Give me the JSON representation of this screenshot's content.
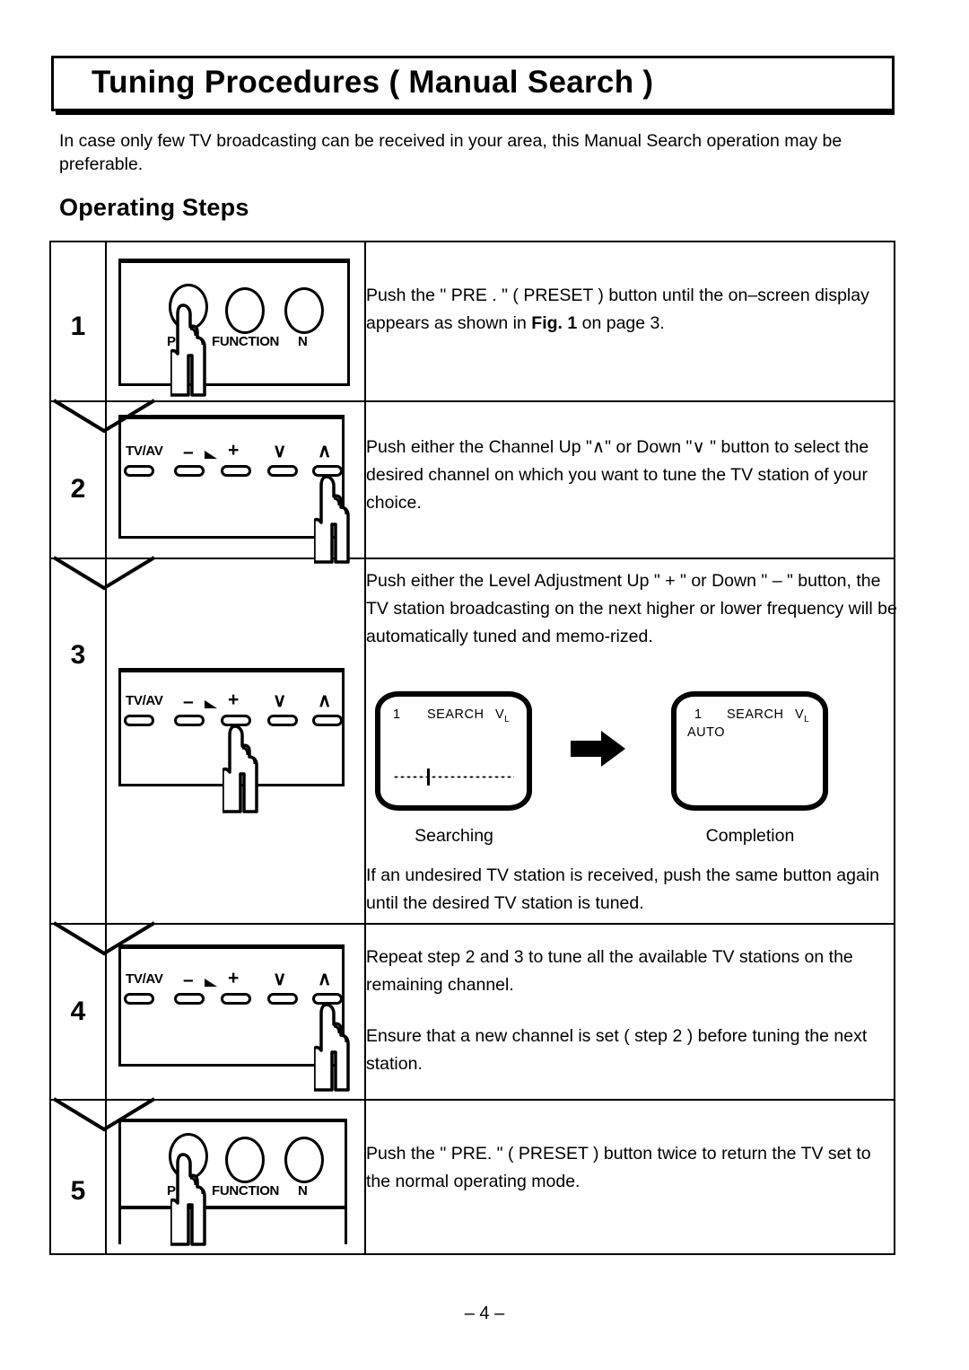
{
  "page": {
    "title": "Tuning Procedures ( Manual Search )",
    "intro": "In case only few TV broadcasting can be received in your area, this Manual Search operation may  be preferable.",
    "section_heading": "Operating Steps",
    "page_number": "– 4 –"
  },
  "panel_labels": {
    "function": "FUNCTION",
    "preset_short": "P",
    "n": "N",
    "tv_av": "TV/AV",
    "minus": "–",
    "plus": "+",
    "ch_down": "∨",
    "ch_up": "∧"
  },
  "steps": [
    {
      "number": "1",
      "figure": "function-buttons",
      "pressed": "preset",
      "text_blocks": [
        {
          "parts": [
            {
              "t": "Push the \" PRE . \" ( PRESET ) button until the on–screen display appears as shown in ",
              "b": false
            },
            {
              "t": "Fig. 1",
              "b": true
            },
            {
              "t": " on page 3.",
              "b": false
            }
          ]
        }
      ]
    },
    {
      "number": "2",
      "figure": "channel-buttons",
      "pressed": "ch-up",
      "text_blocks": [
        {
          "parts": [
            {
              "t": "Push either the Channel Up  \"∧\" or Down \"∨ \" button to select the desired channel on which you want to tune the TV station of  your choice.",
              "b": false
            }
          ]
        }
      ]
    },
    {
      "number": "3",
      "figure": "channel-buttons",
      "pressed": "plus",
      "text_blocks": [
        {
          "parts": [
            {
              "t": "Push either the Level Adjustment Up \" + \" or Down \" – \" button, the TV station broadcasting on the next higher or lower frequency will be automatically tuned and memo-rized.",
              "b": false
            }
          ]
        },
        {
          "parts": [
            {
              "t": "If an undesired TV station is received, push the same button again until the desired TV station is tuned.",
              "b": false
            }
          ]
        }
      ],
      "tv_figures": {
        "searching": {
          "channel": "1",
          "mode": "SEARCH",
          "band": "V",
          "band_sub": "L",
          "caption": "Searching"
        },
        "completion": {
          "channel": "1",
          "mode": "SEARCH",
          "band": "V",
          "band_sub": "L",
          "auto": "AUTO",
          "caption": "Completion"
        }
      }
    },
    {
      "number": "4",
      "figure": "channel-buttons",
      "pressed": "ch-up",
      "text_blocks": [
        {
          "parts": [
            {
              "t": "Repeat step 2 and 3 to tune all the available TV stations on the remaining channel.",
              "b": false
            }
          ]
        },
        {
          "parts": [
            {
              "t": "Ensure that a new channel is set ( step 2 ) before tuning the next station.",
              "b": false
            }
          ]
        }
      ]
    },
    {
      "number": "5",
      "figure": "function-buttons",
      "pressed": "preset",
      "text_blocks": [
        {
          "parts": [
            {
              "t": "Push the \" PRE. \" ( PRESET ) button twice to return the TV set to the normal operating mode.",
              "b": false
            }
          ]
        }
      ]
    }
  ]
}
